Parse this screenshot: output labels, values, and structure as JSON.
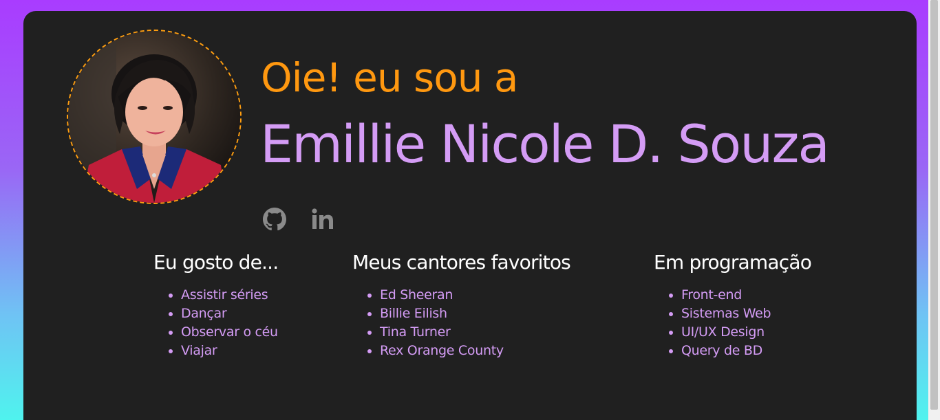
{
  "profile": {
    "greeting": "Oie! eu sou a",
    "name": "Emillie Nicole D. Souza"
  },
  "social": [
    {
      "icon": "github-icon"
    },
    {
      "icon": "linkedin-icon"
    }
  ],
  "lists": [
    {
      "title": "Eu gosto de...",
      "items": [
        "Assistir séries",
        "Dançar",
        "Observar o céu",
        "Viajar"
      ]
    },
    {
      "title": "Meus cantores favoritos",
      "items": [
        "Ed Sheeran",
        "Billie Eilish",
        "Tina Turner",
        "Rex Orange County"
      ]
    },
    {
      "title": "Em programação",
      "items": [
        "Front-end",
        "Sistemas Web",
        "UI/UX Design",
        "Query de BD"
      ]
    }
  ],
  "colors": {
    "greeting": "#ff9810",
    "name": "#d49cf5",
    "card_background": "#202020",
    "avatar_border": "#ff9e10",
    "icon": "#8a8a8a"
  }
}
